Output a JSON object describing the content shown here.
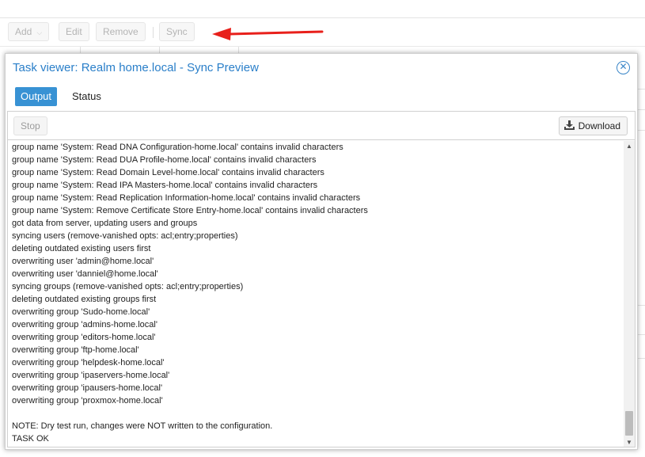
{
  "toolbar": {
    "add_label": "Add",
    "edit_label": "Edit",
    "remove_label": "Remove",
    "sync_label": "Sync",
    "add_icon": "chevron-down-icon"
  },
  "annotation": {
    "arrow_color": "#e8201b",
    "arrow_icon": "red-arrow-pointer-icon"
  },
  "dialog": {
    "title": "Task viewer: Realm home.local - Sync Preview",
    "close_icon": "close-circle-icon",
    "tabs": [
      {
        "label": "Output",
        "active": true
      },
      {
        "label": "Status",
        "active": false
      }
    ],
    "stop_label": "Stop",
    "download_label": "Download",
    "download_icon": "download-icon",
    "accent_color": "#3892d4"
  },
  "log_lines": [
    "group name 'System: Read DNA Configuration-home.local' contains invalid characters",
    "group name 'System: Read DUA Profile-home.local' contains invalid characters",
    "group name 'System: Read Domain Level-home.local' contains invalid characters",
    "group name 'System: Read IPA Masters-home.local' contains invalid characters",
    "group name 'System: Read Replication Information-home.local' contains invalid characters",
    "group name 'System: Remove Certificate Store Entry-home.local' contains invalid characters",
    "got data from server, updating users and groups",
    "syncing users (remove-vanished opts: acl;entry;properties)",
    "deleting outdated existing users first",
    "overwriting user 'admin@home.local'",
    "overwriting user 'danniel@home.local'",
    "syncing groups (remove-vanished opts: acl;entry;properties)",
    "deleting outdated existing groups first",
    "overwriting group 'Sudo-home.local'",
    "overwriting group 'admins-home.local'",
    "overwriting group 'editors-home.local'",
    "overwriting group 'ftp-home.local'",
    "overwriting group 'helpdesk-home.local'",
    "overwriting group 'ipaservers-home.local'",
    "overwriting group 'ipausers-home.local'",
    "overwriting group 'proxmox-home.local'",
    "",
    "NOTE: Dry test run, changes were NOT written to the configuration.",
    "TASK OK"
  ]
}
